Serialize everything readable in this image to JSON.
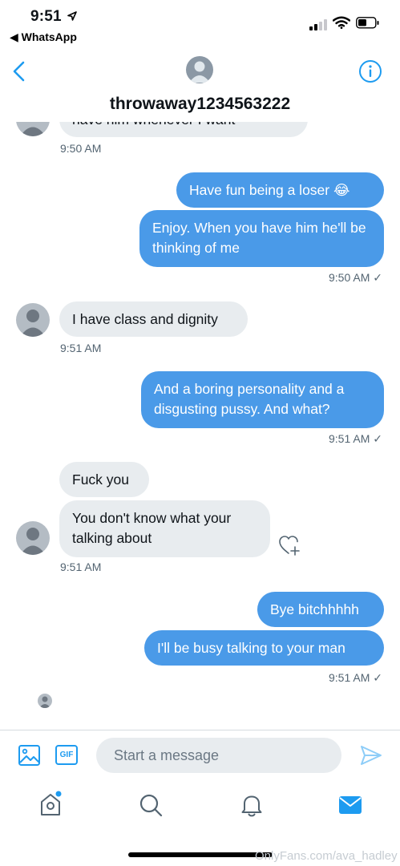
{
  "status_bar": {
    "time": "9:51",
    "back_app": "◀ WhatsApp"
  },
  "header": {
    "name": "throwaway1234563222"
  },
  "messages": [
    {
      "text": "have him whenever I want",
      "time": "9:50 AM"
    },
    {
      "text": "Have fun being a loser 😂"
    },
    {
      "text": "Enjoy. When you have him he'll be thinking of me",
      "time": "9:50 AM ✓"
    },
    {
      "text": "I have class and dignity",
      "time": "9:51 AM"
    },
    {
      "text": "And a boring personality and a disgusting pussy. And what?",
      "time": "9:51 AM ✓"
    },
    {
      "text": "Fuck you"
    },
    {
      "text": "You don't know what your talking about",
      "time": "9:51 AM"
    },
    {
      "text": "Bye bitchhhhh"
    },
    {
      "text": "I'll be busy talking to your man",
      "time": "9:51 AM ✓"
    }
  ],
  "composer": {
    "placeholder": "Start a message",
    "gif_label": "GIF"
  },
  "watermark": "OnlyFans.com/ava_hadley",
  "colors": {
    "accent": "#1d9bf0",
    "outgoing_bubble": "#4a9ae8",
    "incoming_bubble": "#e8ecef"
  }
}
